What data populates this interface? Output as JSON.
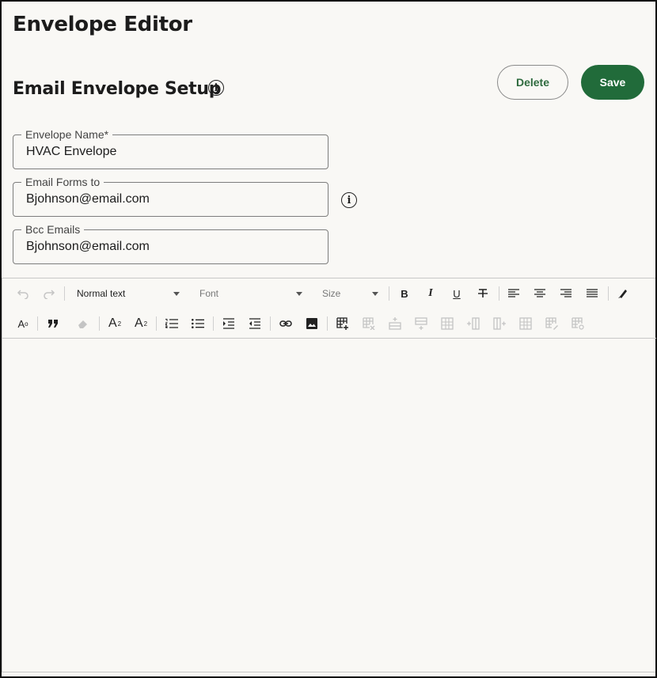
{
  "page": {
    "title": "Envelope Editor"
  },
  "section": {
    "title": "Email Envelope Setup"
  },
  "actions": {
    "delete_label": "Delete",
    "save_label": "Save"
  },
  "fields": {
    "envelope_name": {
      "label": "Envelope Name*",
      "value": "HVAC Envelope"
    },
    "email_forms_to": {
      "label": "Email Forms to",
      "value": "Bjohnson@email.com"
    },
    "bcc_emails": {
      "label": "Bcc Emails",
      "value": "Bjohnson@email.com"
    }
  },
  "toolbar": {
    "paragraph_style": "Normal text",
    "font": "Font",
    "size": "Size",
    "bold": "B",
    "italic": "I",
    "underline": "U",
    "superscript_base": "A",
    "superscript_mark": "2",
    "subscript_base": "A",
    "subscript_mark": "2",
    "font_color": "A",
    "font_color_mark": "o"
  },
  "colors": {
    "primary": "#216b3a",
    "background": "#f9f8f5",
    "border": "#7d7d7d"
  }
}
